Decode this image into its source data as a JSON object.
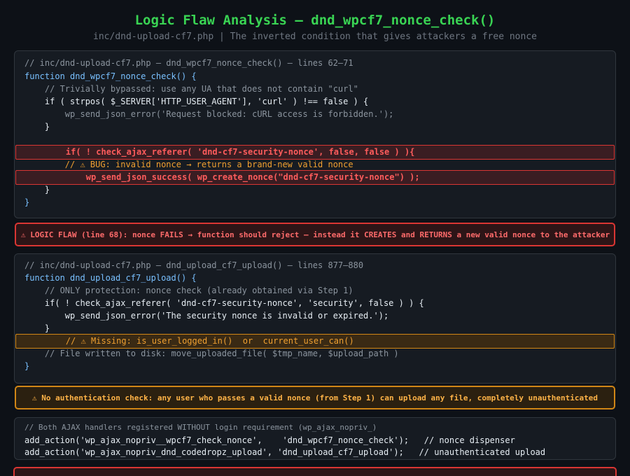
{
  "header": {
    "title": "Logic Flaw Analysis — dnd_wpcf7_nonce_check()",
    "subtitle": "inc/dnd-upload-cf7.php | The inverted condition that gives attackers a free nonce"
  },
  "panel1": {
    "lines": [
      "// inc/dnd-upload-cf7.php — dnd_wpcf7_nonce_check() — lines 62–71",
      "function dnd_wpcf7_nonce_check() {",
      "    // Trivially bypassed: use any UA that does not contain \"curl\"",
      "    if ( strpos( $_SERVER['HTTP_USER_AGENT'], 'curl' ) !== false ) {",
      "        wp_send_json_error('Request blocked: cURL access is forbidden.');",
      "    }",
      "",
      "    if( ! check_ajax_referer( 'dnd-cf7-security-nonce', false, false ) ){",
      "        // ⚠ BUG: invalid nonce → returns a brand-new valid nonce",
      "        wp_send_json_success( wp_create_nonce(\"dnd-cf7-security-nonce\") );",
      "    }",
      "}"
    ]
  },
  "callout1": "⚠ LOGIC FLAW (line 68): nonce FAILS → function should reject — instead it CREATES and RETURNS a new valid nonce to the attacker",
  "panel2": {
    "lines": [
      "// inc/dnd-upload-cf7.php — dnd_upload_cf7_upload() — lines 877–880",
      "function dnd_upload_cf7_upload() {",
      "    // ONLY protection: nonce check (already obtained via Step 1)",
      "    if( ! check_ajax_referer( 'dnd-cf7-security-nonce', 'security', false ) ) {",
      "        wp_send_json_error('The security nonce is invalid or expired.');",
      "    }",
      "    // ⚠ Missing: is_user_logged_in()  or  current_user_can()",
      "    // File written to disk: move_uploaded_file( $tmp_name, $upload_path )",
      "}"
    ]
  },
  "callout2": "⚠ No authentication check: any user who passes a valid nonce (from Step 1) can upload any file, completely unauthenticated",
  "panel3": {
    "lines": [
      "// Both AJAX handlers registered WITHOUT login requirement (wp_ajax_nopriv_)",
      "add_action('wp_ajax_nopriv__wpcf7_check_nonce',    'dnd_wpcf7_nonce_check');   // nonce dispenser",
      "add_action('wp_ajax_nopriv_dnd_codedropz_upload', 'dnd_upload_cf7_upload');   // unauthenticated upload"
    ]
  },
  "colors": {
    "title": "#39d353",
    "danger": "#da3633",
    "warning": "#d18616",
    "background": "#0d1117"
  }
}
